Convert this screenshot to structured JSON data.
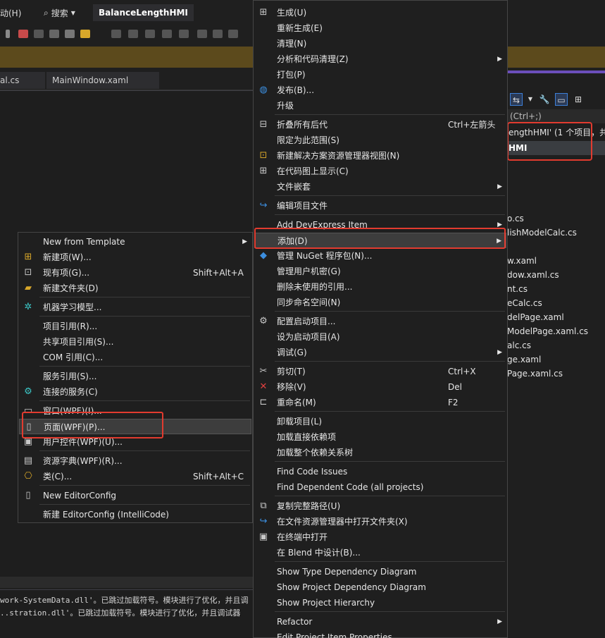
{
  "topbar": {
    "help_label": "动(H)",
    "search_label": "搜索",
    "project_name": "BalanceLengthHMI"
  },
  "document_tabs": [
    "al.cs",
    "MainWindow.xaml"
  ],
  "solution_explorer": {
    "search_text": "(Ctrl+;)",
    "solution_row": "engthHMI' (1 个项目，共",
    "project_row": "HMI",
    "files": [
      "o.cs",
      "lishModelCalc.cs",
      "w.xaml",
      "dow.xaml.cs",
      "nt.cs",
      "eCalc.cs",
      "delPage.xaml",
      "ModelPage.xaml.cs",
      "alc.cs",
      "ge.xaml",
      "Page.xaml.cs"
    ]
  },
  "main_menu": {
    "items": [
      {
        "label": "生成(U)",
        "icon": "build-icon"
      },
      {
        "label": "重新生成(E)"
      },
      {
        "label": "清理(N)"
      },
      {
        "label": "分析和代码清理(Z)",
        "submenu": true
      },
      {
        "label": "打包(P)"
      },
      {
        "label": "发布(B)...",
        "icon": "globe-icon"
      },
      {
        "label": "升级"
      },
      {
        "label": "折叠所有后代",
        "shortcut": "Ctrl+左箭头",
        "icon": "collapse-icon"
      },
      {
        "label": "限定为此范围(S)"
      },
      {
        "label": "新建解决方案资源管理器视图(N)",
        "icon": "new-view-icon"
      },
      {
        "label": "在代码图上显示(C)",
        "icon": "code-map-icon"
      },
      {
        "label": "文件嵌套",
        "submenu": true
      },
      {
        "label": "编辑项目文件",
        "icon": "edit-project-icon"
      },
      {
        "label": "Add DevExpress Item",
        "submenu": true
      },
      {
        "label": "添加(D)",
        "submenu": true
      },
      {
        "label": "管理 NuGet 程序包(N)...",
        "icon": "nuget-icon"
      },
      {
        "label": "管理用户机密(G)"
      },
      {
        "label": "删除未使用的引用..."
      },
      {
        "label": "同步命名空间(N)"
      },
      {
        "label": "配置启动项目...",
        "icon": "gear-icon"
      },
      {
        "label": "设为启动项目(A)"
      },
      {
        "label": "调试(G)",
        "submenu": true
      },
      {
        "label": "剪切(T)",
        "shortcut": "Ctrl+X",
        "icon": "scissors-icon"
      },
      {
        "label": "移除(V)",
        "shortcut": "Del",
        "icon": "remove-icon"
      },
      {
        "label": "重命名(M)",
        "shortcut": "F2",
        "icon": "rename-icon"
      },
      {
        "label": "卸载项目(L)"
      },
      {
        "label": "加载直接依赖项"
      },
      {
        "label": "加载整个依赖关系树"
      },
      {
        "label": "Find Code Issues"
      },
      {
        "label": "Find Dependent Code (all projects)"
      },
      {
        "label": "复制完整路径(U)",
        "icon": "copy-icon"
      },
      {
        "label": "在文件资源管理器中打开文件夹(X)",
        "icon": "open-folder-icon"
      },
      {
        "label": "在终端中打开",
        "icon": "terminal-icon"
      },
      {
        "label": "在 Blend 中设计(B)..."
      },
      {
        "label": "Show Type Dependency Diagram"
      },
      {
        "label": "Show Project Dependency Diagram"
      },
      {
        "label": "Show Project Hierarchy"
      },
      {
        "label": "Refactor",
        "submenu": true
      },
      {
        "label": "Edit Project Item Properties"
      }
    ]
  },
  "add_menu": {
    "items": [
      {
        "label": "New from Template",
        "submenu": true
      },
      {
        "label": "新建项(W)...",
        "icon": "new-item-icon"
      },
      {
        "label": "现有项(G)...",
        "shortcut": "Shift+Alt+A",
        "icon": "existing-item-icon"
      },
      {
        "label": "新建文件夹(D)",
        "icon": "new-folder-icon"
      },
      {
        "label": "机器学习模型...",
        "icon": "ml-model-icon"
      },
      {
        "label": "项目引用(R)..."
      },
      {
        "label": "共享项目引用(S)..."
      },
      {
        "label": "COM 引用(C)..."
      },
      {
        "label": "服务引用(S)..."
      },
      {
        "label": "连接的服务(C)",
        "icon": "connected-service-icon"
      },
      {
        "label": "窗口(WPF)(I)...",
        "icon": "window-icon"
      },
      {
        "label": "页面(WPF)(P)...",
        "icon": "page-icon"
      },
      {
        "label": "用户控件(WPF)(U)...",
        "icon": "user-control-icon"
      },
      {
        "label": "资源字典(WPF)(R)...",
        "icon": "resource-dictionary-icon"
      },
      {
        "label": "类(C)...",
        "shortcut": "Shift+Alt+C",
        "icon": "class-icon"
      },
      {
        "label": "New EditorConfig",
        "icon": "editorconfig-icon"
      },
      {
        "label": "新建 EditorConfig (IntelliCode)"
      }
    ]
  },
  "output_lines": [
    "work-SystemData.dll'。已跳过加载符号。模块进行了优化，并且调",
    "..stration.dll'。已跳过加载符号。模块进行了优化，并且调试器"
  ],
  "colors": {
    "highlight_border": "#e23b2f",
    "accent_purple": "#6b4fbb",
    "info_bar": "#5c4a1c"
  }
}
